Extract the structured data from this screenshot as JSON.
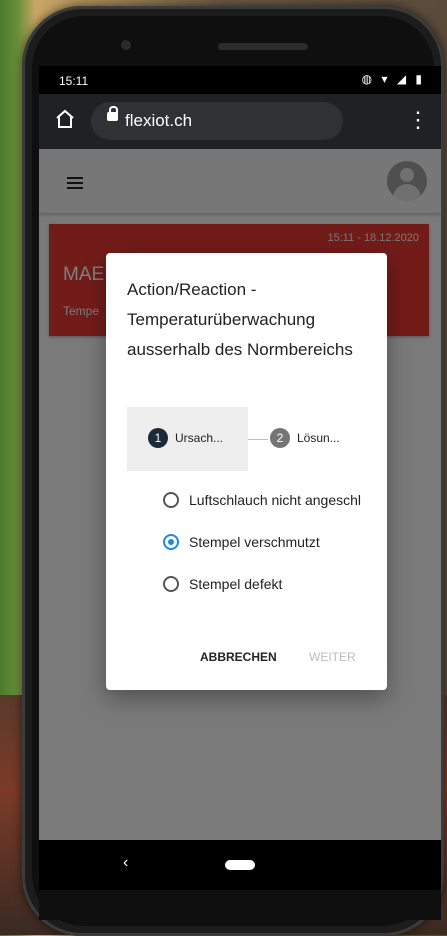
{
  "status_bar": {
    "time": "15:11",
    "icons": "vibrate-icon wifi-icon signal-icon battery-icon"
  },
  "browser": {
    "url": "flexiot.ch",
    "menu_glyph": "⋮"
  },
  "card": {
    "timestamp": "15:11 - 18.12.2020",
    "title": "MAE",
    "subtitle": "Tempe",
    "color": "#e53935"
  },
  "dialog": {
    "title": "Action/Reaction - Temperaturüberwachung ausserhalb des Normbereichs",
    "steps": [
      {
        "number": "1",
        "label": "Ursach..."
      },
      {
        "number": "2",
        "label": "Lösun..."
      }
    ],
    "options": [
      {
        "label": "Luftschlauch nicht angeschl",
        "checked": false
      },
      {
        "label": "Stempel verschmutzt",
        "checked": true
      },
      {
        "label": "Stempel defekt",
        "checked": false
      }
    ],
    "cancel_label": "ABBRECHEN",
    "next_label": "WEITER"
  },
  "nav": {
    "back_glyph": "‹"
  },
  "colors": {
    "accent": "#1e88e5",
    "step_active": "#1e2a3a"
  }
}
